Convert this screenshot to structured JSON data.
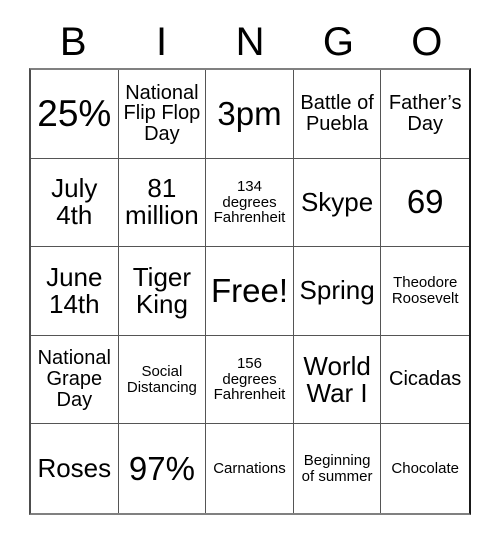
{
  "card": {
    "title": "BINGO Card",
    "header_letters": [
      "B",
      "I",
      "N",
      "G",
      "O"
    ],
    "colors": {
      "background": "#ffffff",
      "text": "#000000",
      "grid_line": "#555555",
      "grid_border": "#1a1a1a"
    },
    "grid_size": "5x5",
    "rows": [
      [
        {
          "text": "25%",
          "size": "xl"
        },
        {
          "text": "National Flip Flop Day",
          "size": "sm"
        },
        {
          "text": "3pm",
          "size": "lg"
        },
        {
          "text": "Battle of Puebla",
          "size": "sm"
        },
        {
          "text": "Father’s Day",
          "size": "sm"
        }
      ],
      [
        {
          "text": "July 4th",
          "size": "md"
        },
        {
          "text": "81 million",
          "size": "md"
        },
        {
          "text": "134 degrees Fahrenheit",
          "size": "xs"
        },
        {
          "text": "Skype",
          "size": "md"
        },
        {
          "text": "69",
          "size": "lg"
        }
      ],
      [
        {
          "text": "June 14th",
          "size": "md"
        },
        {
          "text": "Tiger King",
          "size": "md"
        },
        {
          "text": "Free!",
          "size": "lg"
        },
        {
          "text": "Spring",
          "size": "md"
        },
        {
          "text": "Theodore Roosevelt",
          "size": "xs"
        }
      ],
      [
        {
          "text": "National Grape Day",
          "size": "sm"
        },
        {
          "text": "Social Distancing",
          "size": "xs"
        },
        {
          "text": "156 degrees Fahrenheit",
          "size": "xs"
        },
        {
          "text": "World War I",
          "size": "md"
        },
        {
          "text": "Cicadas",
          "size": "sm"
        }
      ],
      [
        {
          "text": "Roses",
          "size": "md"
        },
        {
          "text": "97%",
          "size": "lg"
        },
        {
          "text": "Carnations",
          "size": "xs"
        },
        {
          "text": "Beginning of summer",
          "size": "xs"
        },
        {
          "text": "Chocolate",
          "size": "xs"
        }
      ]
    ]
  }
}
